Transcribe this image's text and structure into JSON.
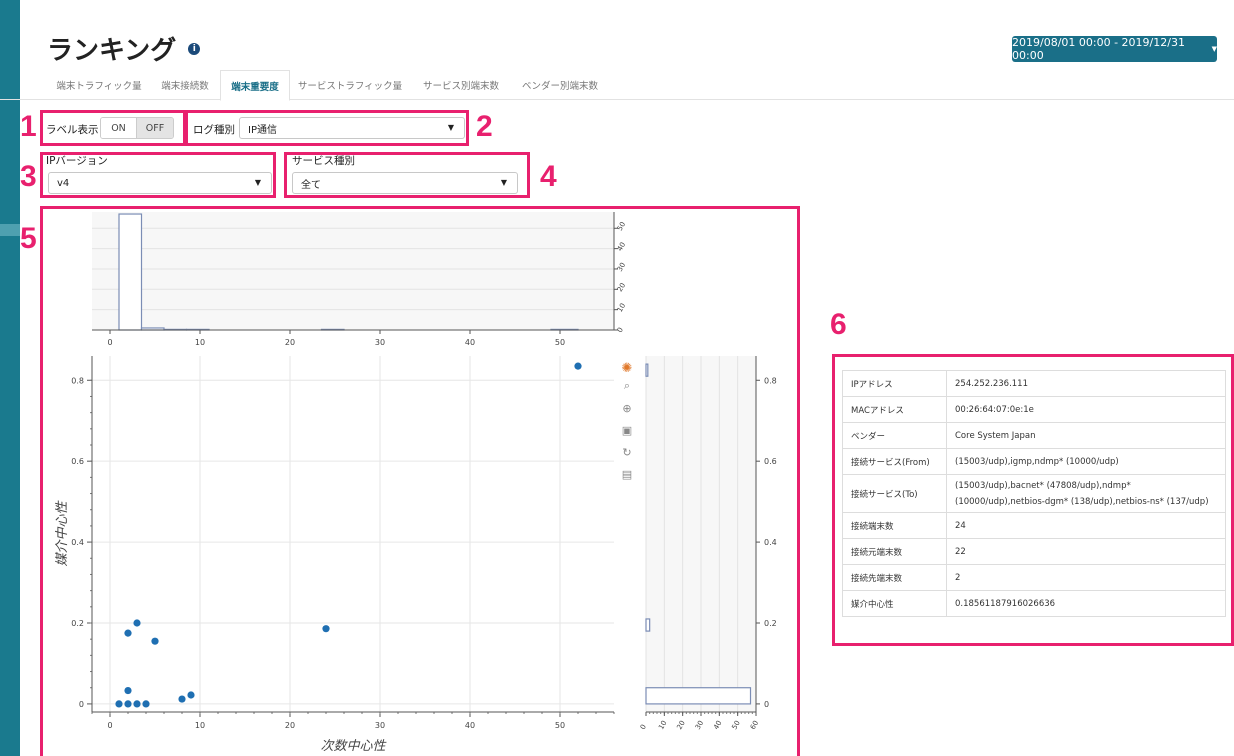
{
  "page": {
    "title": "ランキング",
    "date_range": "2019/08/01 00:00 - 2019/12/31 00:00"
  },
  "tabs": [
    {
      "label": "端末トラフィック量",
      "active": false
    },
    {
      "label": "端末接続数",
      "active": false
    },
    {
      "label": "端末重要度",
      "active": true
    },
    {
      "label": "サービストラフィック量",
      "active": false
    },
    {
      "label": "サービス別端末数",
      "active": false
    },
    {
      "label": "ベンダー別端末数",
      "active": false
    }
  ],
  "annotations": [
    "1",
    "2",
    "3",
    "4",
    "5",
    "6"
  ],
  "controls": {
    "label_display": {
      "label": "ラベル表示",
      "on": "ON",
      "off": "OFF",
      "selected": "OFF"
    },
    "log_type": {
      "label": "ログ種別",
      "value": "IP通信"
    },
    "ip_version": {
      "label": "IPバージョン",
      "value": "v4"
    },
    "service_type": {
      "label": "サービス種別",
      "value": "全て"
    }
  },
  "detail": {
    "rows": [
      {
        "key": "IPアドレス",
        "value": "254.252.236.111"
      },
      {
        "key": "MACアドレス",
        "value": "00:26:64:07:0e:1e"
      },
      {
        "key": "ベンダー",
        "value": "Core System Japan"
      },
      {
        "key": "接続サービス(From)",
        "value": "(15003/udp),igmp,ndmp* (10000/udp)"
      },
      {
        "key": "接続サービス(To)",
        "value": "(15003/udp),bacnet* (47808/udp),ndmp* (10000/udp),netbios-dgm* (138/udp),netbios-ns* (137/udp)"
      },
      {
        "key": "接続端末数",
        "value": "24"
      },
      {
        "key": "接続元端末数",
        "value": "22"
      },
      {
        "key": "接続先端末数",
        "value": "2"
      },
      {
        "key": "媒介中心性",
        "value": "0.18561187916026636"
      }
    ]
  },
  "chart_data": {
    "type": "scatter",
    "xlabel": "次数中心性",
    "ylabel": "媒介中心性",
    "xlim": [
      -2,
      56
    ],
    "ylim": [
      -0.02,
      0.86
    ],
    "x_ticks": [
      0,
      10,
      20,
      30,
      40,
      50
    ],
    "y_ticks": [
      0,
      0.2,
      0.4,
      0.6,
      0.8
    ],
    "grid": true,
    "points": [
      {
        "x": 1,
        "y": 0
      },
      {
        "x": 2,
        "y": 0
      },
      {
        "x": 3,
        "y": 0
      },
      {
        "x": 4,
        "y": 0
      },
      {
        "x": 2,
        "y": 0.175
      },
      {
        "x": 3,
        "y": 0.2
      },
      {
        "x": 5,
        "y": 0.155
      },
      {
        "x": 2,
        "y": 0.033
      },
      {
        "x": 8,
        "y": 0.012
      },
      {
        "x": 9,
        "y": 0.022
      },
      {
        "x": 24,
        "y": 0.186
      },
      {
        "x": 52,
        "y": 0.835
      }
    ],
    "x_histogram": {
      "bins": [
        {
          "x0": 1,
          "x1": 3.5,
          "count": 57
        },
        {
          "x0": 3.5,
          "x1": 6,
          "count": 1
        },
        {
          "x0": 6,
          "x1": 8.5,
          "count": 0.3
        },
        {
          "x0": 8.5,
          "x1": 11,
          "count": 0.3
        },
        {
          "x0": 23.5,
          "x1": 26,
          "count": 0.3
        },
        {
          "x0": 49,
          "x1": 52,
          "count": 0.3
        }
      ],
      "ylim": [
        0,
        58
      ],
      "ticks": [
        0,
        10,
        20,
        30,
        40,
        50
      ]
    },
    "y_histogram": {
      "bins": [
        {
          "y0": 0,
          "y1": 0.04,
          "count": 57
        },
        {
          "y0": 0.18,
          "y1": 0.21,
          "count": 2
        },
        {
          "y0": 0.81,
          "y1": 0.84,
          "count": 1
        }
      ],
      "xlim": [
        0,
        60
      ],
      "ticks": [
        0,
        10,
        20,
        30,
        40,
        50,
        60
      ]
    },
    "point_color": "#1f6fb2"
  },
  "toolbar": {
    "tools": [
      {
        "name": "bokeh-logo-icon",
        "glyph": "✺"
      },
      {
        "name": "box-zoom-icon",
        "glyph": "⌕"
      },
      {
        "name": "pan-icon",
        "glyph": "⊕"
      },
      {
        "name": "save-icon",
        "glyph": "▣"
      },
      {
        "name": "reset-icon",
        "glyph": "↻"
      },
      {
        "name": "hover-icon",
        "glyph": "▤"
      }
    ]
  }
}
